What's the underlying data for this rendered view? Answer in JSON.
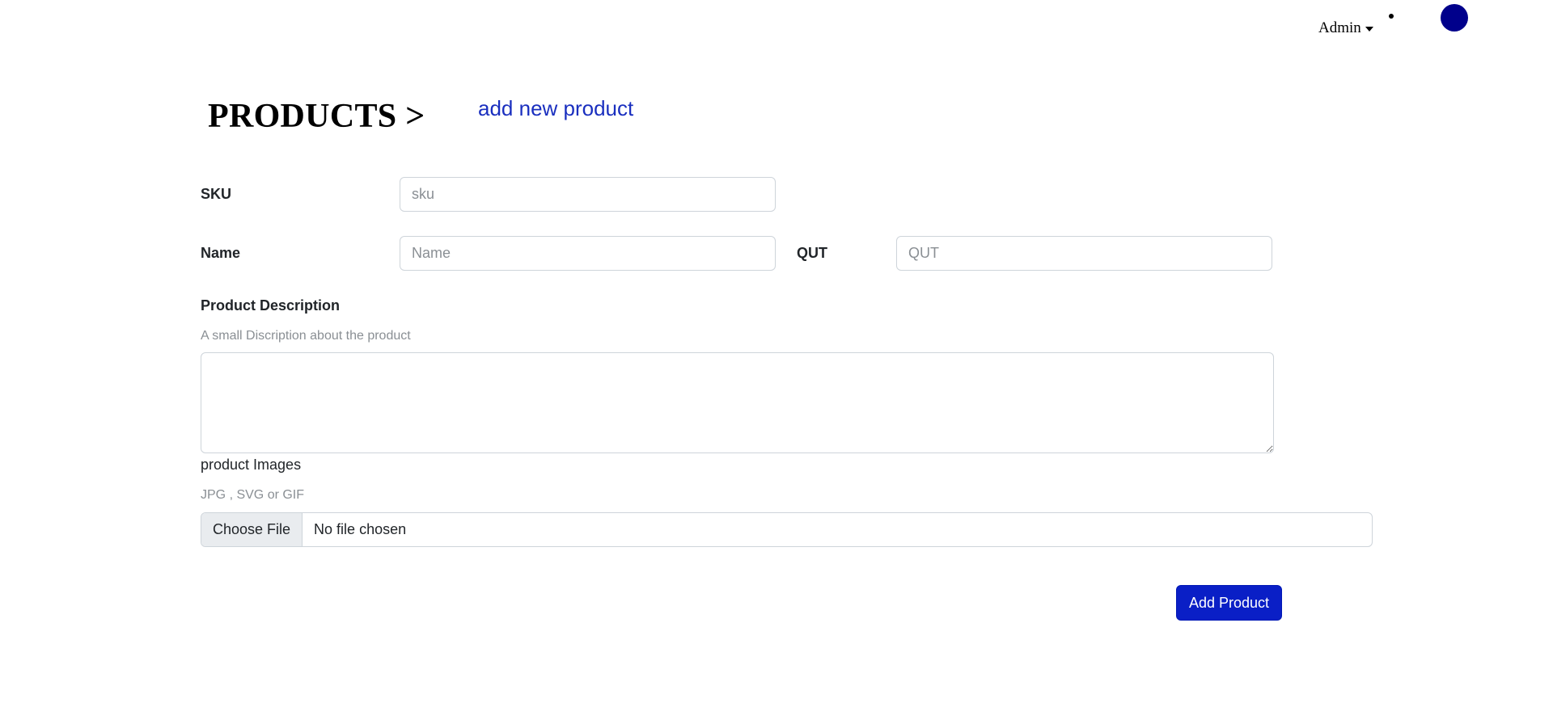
{
  "nav": {
    "admin_label": "Admin"
  },
  "header": {
    "title": "PRODUCTS >",
    "breadcrumb_link": "add new product"
  },
  "form": {
    "sku": {
      "label": "SKU",
      "placeholder": "sku",
      "value": ""
    },
    "name": {
      "label": "Name",
      "placeholder": "Name",
      "value": ""
    },
    "qut": {
      "label": "QUT",
      "placeholder": "QUT",
      "value": ""
    },
    "description": {
      "label": "Product Description",
      "hint": "A small Discription about the product",
      "value": ""
    },
    "images": {
      "label": "product Images",
      "hint": "JPG , SVG or GIF",
      "button_label": "Choose File",
      "status": "No file chosen"
    },
    "submit_label": "Add Product"
  },
  "colors": {
    "avatar": "#00008b",
    "link": "#1a2fbf",
    "primary_button": "#0a1fc6"
  }
}
